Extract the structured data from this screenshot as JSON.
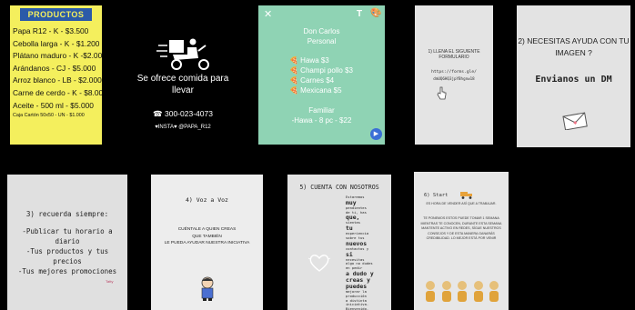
{
  "productos": {
    "title": "PRODUCTOS",
    "items": [
      "Papa R12 - K - $3.500",
      "Cebolla larga - K - $1.200",
      "Plátano maduro - K -$2.000",
      "Arándanos - CJ - $5.000",
      "Arroz blanco - LB - $2.000",
      "Carne de cerdo - K - $8.000",
      "Aceite - 500 ml - $5.000"
    ],
    "small_item": "Caja Cartón 50x50 - UN - $1.000"
  },
  "oferta": {
    "slogan_line1": "Se ofrece comida para",
    "slogan_line2": "llevar",
    "phone": "☎ 300-023-4073",
    "insta": "♥INSTA♥ @PAPA_R12",
    "icon": "delivery-scooter-icon"
  },
  "menu": {
    "close": "✕",
    "text_tool": "T",
    "palette": "🎨",
    "header_line1": "Don Carlos",
    "header_line2": "Personal",
    "items": [
      "🍕 Hawa $3",
      "🍕 Champi pollo $3",
      "🍕 Carnes $4",
      "🍕 Mexicana $5"
    ],
    "familiar_title": "Familiar",
    "familiar_line": "-Hawa - 8 pc - $22",
    "send": "▶",
    "bg_color": "#8fd3b4"
  },
  "formulario": {
    "title": "1) LLENA EL SIGUIENTE FORMULARIO",
    "url_line1": "https://forms.gle/",
    "url_line2": "dmUQ6HQ3jpYBhgnw18",
    "icon": "pointing-hand-icon"
  },
  "ayuda": {
    "question_line1": "2) NECESITAS AYUDA CON TU",
    "question_line2": "IMAGEN ?",
    "dm": "Envianos un DM",
    "icon": "envelope-icon"
  },
  "recuerda": {
    "heading": "3) recuerda siempre:",
    "lines": [
      "-Publicar tu horario a",
      "diario",
      "-Tus productos y tus",
      "precios",
      "-Tus mejores promociones"
    ],
    "signature": "Tatty"
  },
  "voz": {
    "heading": "4) Voz a Voz",
    "lines": [
      "CUÉNTALE A QUIEN CREAS",
      "QUE TAMBIÉN",
      "LE PUEDA AYUDAR NUESTRA INICIATIVA"
    ],
    "icon": "cartoon-person-icon"
  },
  "cuenta": {
    "heading": "5) CUENTA CON NOSOTROS",
    "body_lines": [
      [
        "Estaremos",
        false
      ],
      [
        "muy",
        true
      ],
      [
        "pendientes",
        false
      ],
      [
        "de ti, has",
        false
      ],
      [
        "que,",
        true
      ],
      [
        "sientas",
        false
      ],
      [
        "tu",
        true
      ],
      [
        "experiencia",
        false
      ],
      [
        "sobre tus",
        false
      ],
      [
        "nuevos",
        true
      ],
      [
        "contactos y",
        false
      ],
      [
        "si",
        true
      ],
      [
        "necesitas",
        false
      ],
      [
        "algo no dudes",
        false
      ],
      [
        "en pedir",
        false
      ],
      [
        "a dudo y",
        true
      ],
      [
        "creas y",
        true
      ],
      [
        "puedes",
        true
      ],
      [
        "mejorar la",
        false
      ],
      [
        "producción",
        false
      ],
      [
        "a distinta",
        false
      ],
      [
        "iniciativa.",
        false
      ],
      [
        "Bienvenido.",
        false
      ]
    ],
    "icon": "heart-outline-icon"
  },
  "start": {
    "heading": "6) Start",
    "line1": "ES HORA DE VENDER ASÍ QUE A TRABAJAR.",
    "body": "TE PONEMOS ESTOS PUEDE TOMAR 1 SEMANA MIENTRAS TE CONOCEN, DURANTE ESTA SEMANA MANTENTE ACTIVO EN REDES, SÍGUE NUESTROS CONSEJOS Y DE ESTA MANERA GANARÁS CREDIBILIDAD. LO MEJOR ESTÁ POR VENIR",
    "icon": "truck-icon"
  }
}
